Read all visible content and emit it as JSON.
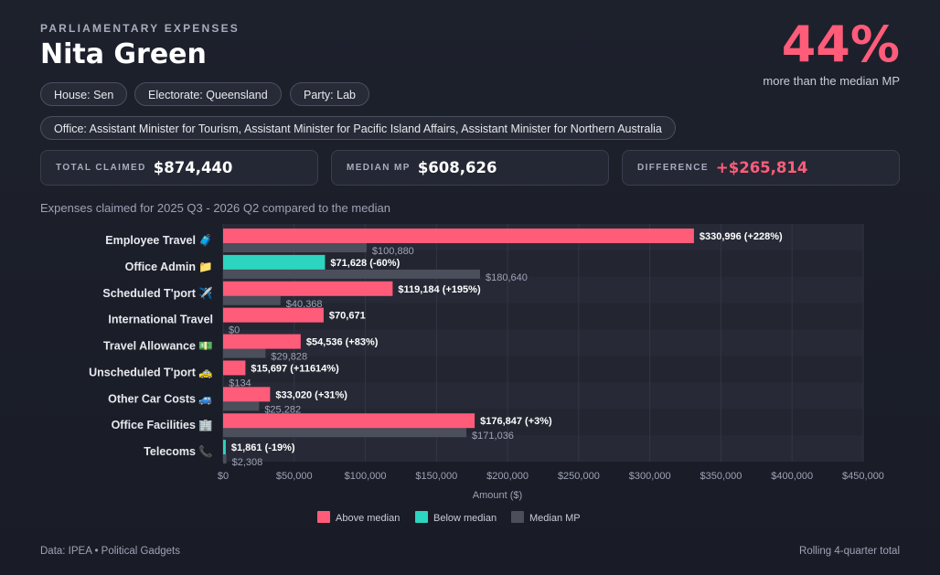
{
  "header": {
    "kicker": "PARLIAMENTARY EXPENSES",
    "name": "Nita Green",
    "headline_pct": "44%",
    "headline_sub": "more than the median MP"
  },
  "chips": {
    "house": "House: Sen",
    "electorate": "Electorate: Queensland",
    "party": "Party: Lab",
    "office": "Office: Assistant Minister for Tourism, Assistant Minister for Pacific Island Affairs, Assistant Minister for Northern Australia"
  },
  "stats": {
    "total_label": "TOTAL CLAIMED",
    "total_value": "$874,440",
    "median_label": "MEDIAN MP",
    "median_value": "$608,626",
    "diff_label": "DIFFERENCE",
    "diff_value": "+$265,814"
  },
  "subtitle": "Expenses claimed for 2025 Q3 - 2026 Q2 compared to the median",
  "footer": {
    "source": "Data: IPEA • Political Gadgets",
    "note": "Rolling 4-quarter total"
  },
  "colors": {
    "above": "#ff5c7a",
    "below": "#2dd4bf",
    "median": "#4b4e5b"
  },
  "chart_data": {
    "type": "bar",
    "orientation": "horizontal",
    "categories": [
      "Employee Travel",
      "Office Admin",
      "Scheduled T'port",
      "International Travel",
      "Travel Allowance",
      "Unscheduled T'port",
      "Other Car Costs",
      "Office Facilities",
      "Telecoms"
    ],
    "category_icons": [
      "🧳",
      "📁",
      "✈️",
      "",
      "💵",
      "🚕",
      "🚙",
      "🏢",
      "📞"
    ],
    "series": [
      {
        "name": "MP",
        "values": [
          330996,
          71628,
          119184,
          70671,
          54536,
          15697,
          33020,
          176847,
          1861
        ],
        "labels": [
          "$330,996 (+228%)",
          "$71,628 (-60%)",
          "$119,184 (+195%)",
          "$70,671",
          "$54,536 (+83%)",
          "$15,697 (+11614%)",
          "$33,020 (+31%)",
          "$176,847 (+3%)",
          "$1,861 (-19%)"
        ]
      },
      {
        "name": "Median MP",
        "values": [
          100880,
          180640,
          40368,
          0,
          29828,
          134,
          25282,
          171036,
          2308
        ],
        "labels": [
          "$100,880",
          "$180,640",
          "$40,368",
          "$0",
          "$29,828",
          "$134",
          "$25,282",
          "$171,036",
          "$2,308"
        ]
      }
    ],
    "xlabel": "Amount ($)",
    "xlim": [
      0,
      450000
    ],
    "xticks": [
      0,
      50000,
      100000,
      150000,
      200000,
      250000,
      300000,
      350000,
      400000,
      450000
    ],
    "xtick_labels": [
      "$0",
      "$50,000",
      "$100,000",
      "$150,000",
      "$200,000",
      "$250,000",
      "$300,000",
      "$350,000",
      "$400,000",
      "$450,000"
    ],
    "legend": {
      "placement": "bottom-center",
      "items": [
        "Above median",
        "Below median",
        "Median MP"
      ]
    },
    "grid": true
  }
}
